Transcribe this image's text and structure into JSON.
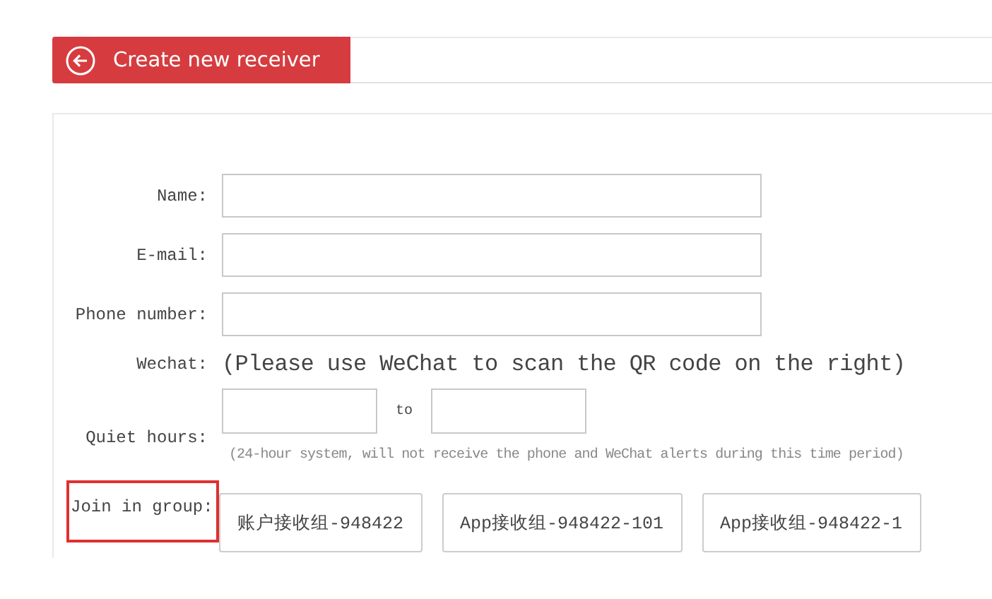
{
  "header": {
    "title": "Create new receiver"
  },
  "fields": [
    {
      "label": "Name:"
    },
    {
      "label": "E-mail:"
    },
    {
      "label": "Phone number:"
    }
  ],
  "wechat": {
    "label": "Wechat:",
    "note": "(Please use WeChat to scan the QR code on the right)"
  },
  "quiet_hours": {
    "label": "Quiet hours:",
    "separator": "to",
    "note": "(24-hour system,  will not receive the phone and WeChat alerts during  this time period)"
  },
  "groups": {
    "label": "Join in group:",
    "highlighted": true,
    "items": [
      {
        "label": "账户接收组-948422"
      },
      {
        "label": "App接收组-948422-101"
      },
      {
        "label": "App接收组-948422-1"
      }
    ]
  }
}
